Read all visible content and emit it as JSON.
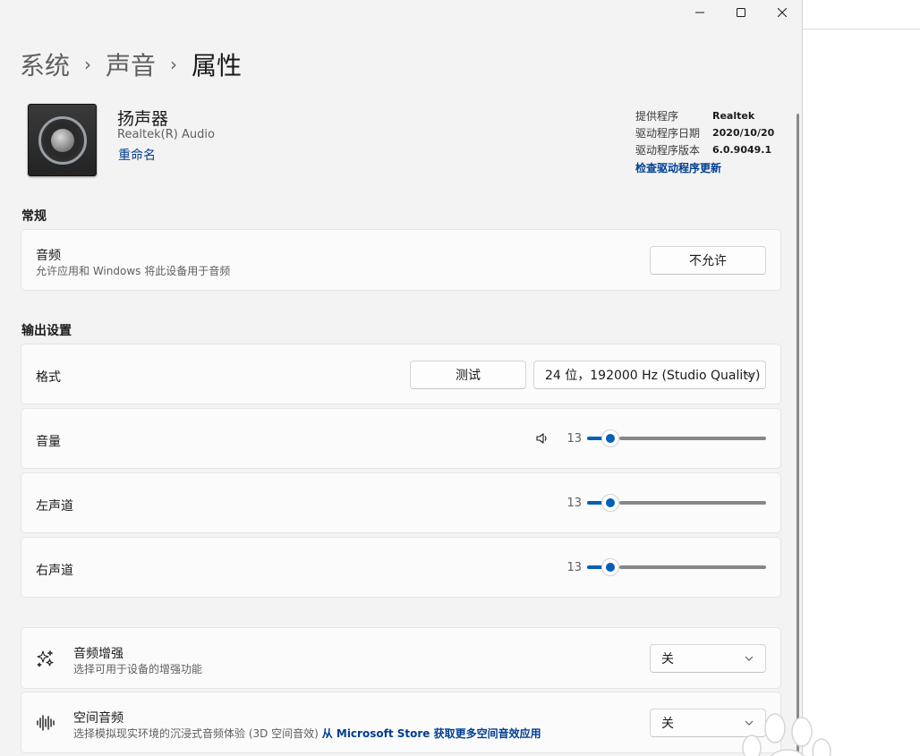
{
  "breadcrumb": {
    "items": [
      "系统",
      "声音"
    ],
    "current": "属性"
  },
  "device": {
    "name": "扬声器",
    "subtitle": "Realtek(R) Audio",
    "rename_link": "重命名"
  },
  "driver": {
    "provider_label": "提供程序",
    "provider_value": "Realtek",
    "date_label": "驱动程序日期",
    "date_value": "2020/10/20",
    "version_label": "驱动程序版本",
    "version_value": "6.0.9049.1",
    "update_link": "检查驱动程序更新"
  },
  "general": {
    "section_title": "常规",
    "audio_title": "音频",
    "audio_desc": "允许应用和 Windows 将此设备用于音频",
    "audio_button": "不允许"
  },
  "output": {
    "section_title": "输出设置",
    "format_label": "格式",
    "test_button": "测试",
    "format_value": "24 位，192000 Hz (Studio Quality)",
    "volume_label": "音量",
    "volume_value": "13",
    "volume_level": 13,
    "left_label": "左声道",
    "left_value": "13",
    "left_level": 13,
    "right_label": "右声道",
    "right_value": "13",
    "right_level": 13
  },
  "enhance": {
    "title": "音频增强",
    "desc": "选择可用于设备的增强功能",
    "value": "关"
  },
  "spatial": {
    "title": "空间音频",
    "desc": "选择模拟现实环境的沉浸式音频体验 (3D 空间音效)",
    "store_link": "从 Microsoft Store 获取更多空间音效应用",
    "value": "关"
  },
  "colors": {
    "accent": "#005fb8",
    "link": "#003e92",
    "background": "#f3f3f3",
    "card": "#fbfbfb"
  },
  "icons": {
    "minimize": "minimize-icon",
    "maximize": "maximize-icon",
    "close": "close-icon",
    "volume": "speaker-icon",
    "enhance": "sparkle-icon",
    "spatial": "soundwave-icon"
  }
}
